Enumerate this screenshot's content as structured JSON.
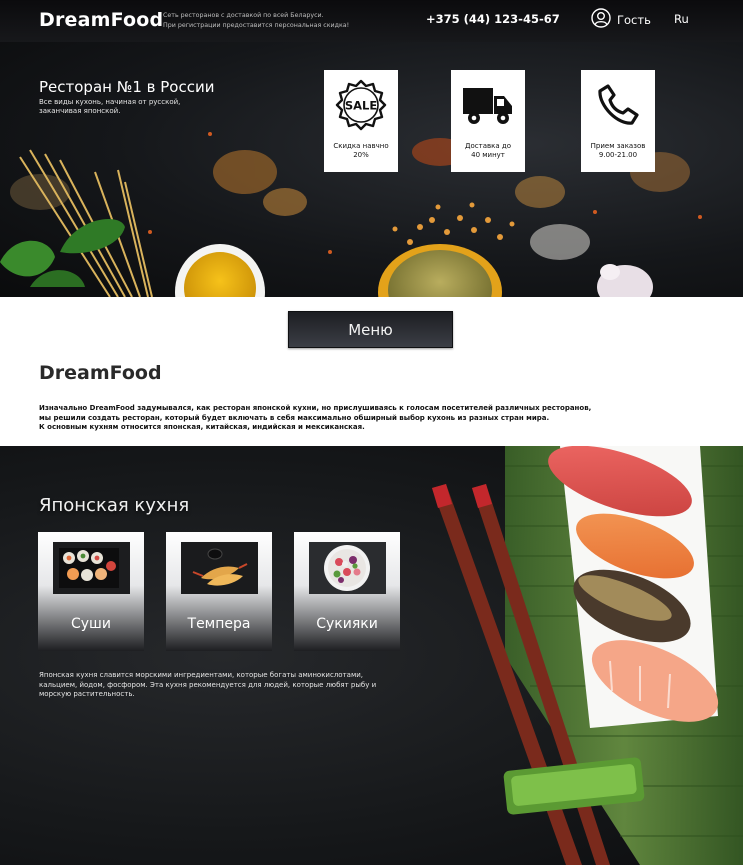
{
  "header": {
    "logo": "DreamFood",
    "tagline_line1": "Сеть ресторанов с доставкой по всей Беларуси.",
    "tagline_line2": "При регистрации предоставится персональная скидка!",
    "phone": "+375 (44) 123-45-67",
    "user_label": "Гость",
    "language": "Ru"
  },
  "hero": {
    "title": "Ресторан №1 в России",
    "subtitle": "Все виды кухонь, начиная от русской, заканчивая японской.",
    "cards": [
      {
        "icon": "sale-badge-icon",
        "badge_text": "SALE",
        "line1": "Скидка навчно",
        "line2": "20%"
      },
      {
        "icon": "delivery-truck-icon",
        "line1": "Доставка до",
        "line2": "40 минут"
      },
      {
        "icon": "phone-handset-icon",
        "line1": "Прием заказов",
        "line2": "9.00-21.00"
      }
    ]
  },
  "menu_button": "Меню",
  "about": {
    "title": "DreamFood",
    "line1": "Изначально DreamFood задумывался, как ресторан японской кухни, но прислушиваясь к голосам посетителей различных ресторанов,",
    "line2": "мы решили создать ресторан, который будет включать в себя максимально обширный выбор кухонь из разных стран мира.",
    "line3": "К основным кухням относится японская, китайская, индийская и мексиканская."
  },
  "japanese": {
    "title": "Японская кухня",
    "dishes": [
      {
        "name": "Суши"
      },
      {
        "name": "Темпера"
      },
      {
        "name": "Сукияки"
      }
    ],
    "description": "Японская кухня славится морскими ингредиентами, которые богаты аминокислотами, кальцием, йодом, фосфором. Эта кухня рекомендуется для людей, которые любят рыбу и морскую растительность."
  },
  "colors": {
    "header_bg": "#111214",
    "hero_bg": "#1a1c1f",
    "card_bg": "#ffffff",
    "menu_button_bg": "#2c2e33",
    "cuisine_bg": "#17191b"
  }
}
